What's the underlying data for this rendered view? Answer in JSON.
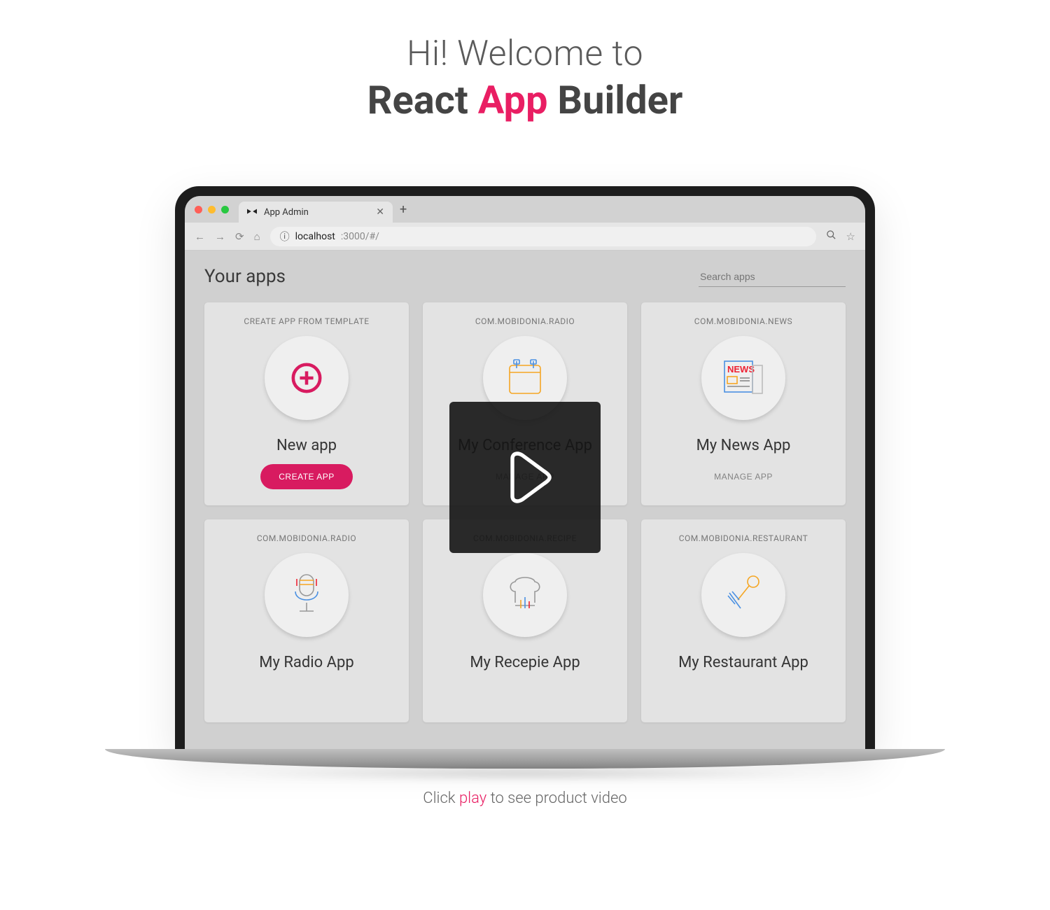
{
  "headline": {
    "line1": "Hi! Welcome to",
    "line2_a": "React ",
    "line2_b": "App",
    "line2_c": " Builder"
  },
  "browser": {
    "tabTitle": "App Admin",
    "urlInfoIcon": "ⓘ",
    "urlHost": "localhost",
    "urlRest": ":3000/#/"
  },
  "page": {
    "title": "Your apps",
    "searchPlaceholder": "Search apps"
  },
  "cards": [
    {
      "subtitle": "CREATE APP FROM TEMPLATE",
      "title": "New app",
      "button": "CREATE APP",
      "primary": true
    },
    {
      "subtitle": "COM.MOBIDONIA.RADIO",
      "title": "My Conference App",
      "button": "MANAGE APP",
      "primary": false
    },
    {
      "subtitle": "COM.MOBIDONIA.NEWS",
      "title": "My News App",
      "button": "MANAGE APP",
      "primary": false
    },
    {
      "subtitle": "COM.MOBIDONIA.RADIO",
      "title": "My Radio App",
      "button": "",
      "primary": false
    },
    {
      "subtitle": "COM.MOBIDONIA.RECIPE",
      "title": "My Recepie App",
      "button": "",
      "primary": false
    },
    {
      "subtitle": "COM.MOBIDONIA.RESTAURANT",
      "title": "My Restaurant App",
      "button": "",
      "primary": false
    }
  ],
  "footnote": {
    "a": "Click ",
    "b": "play",
    "c": " to see product video"
  }
}
